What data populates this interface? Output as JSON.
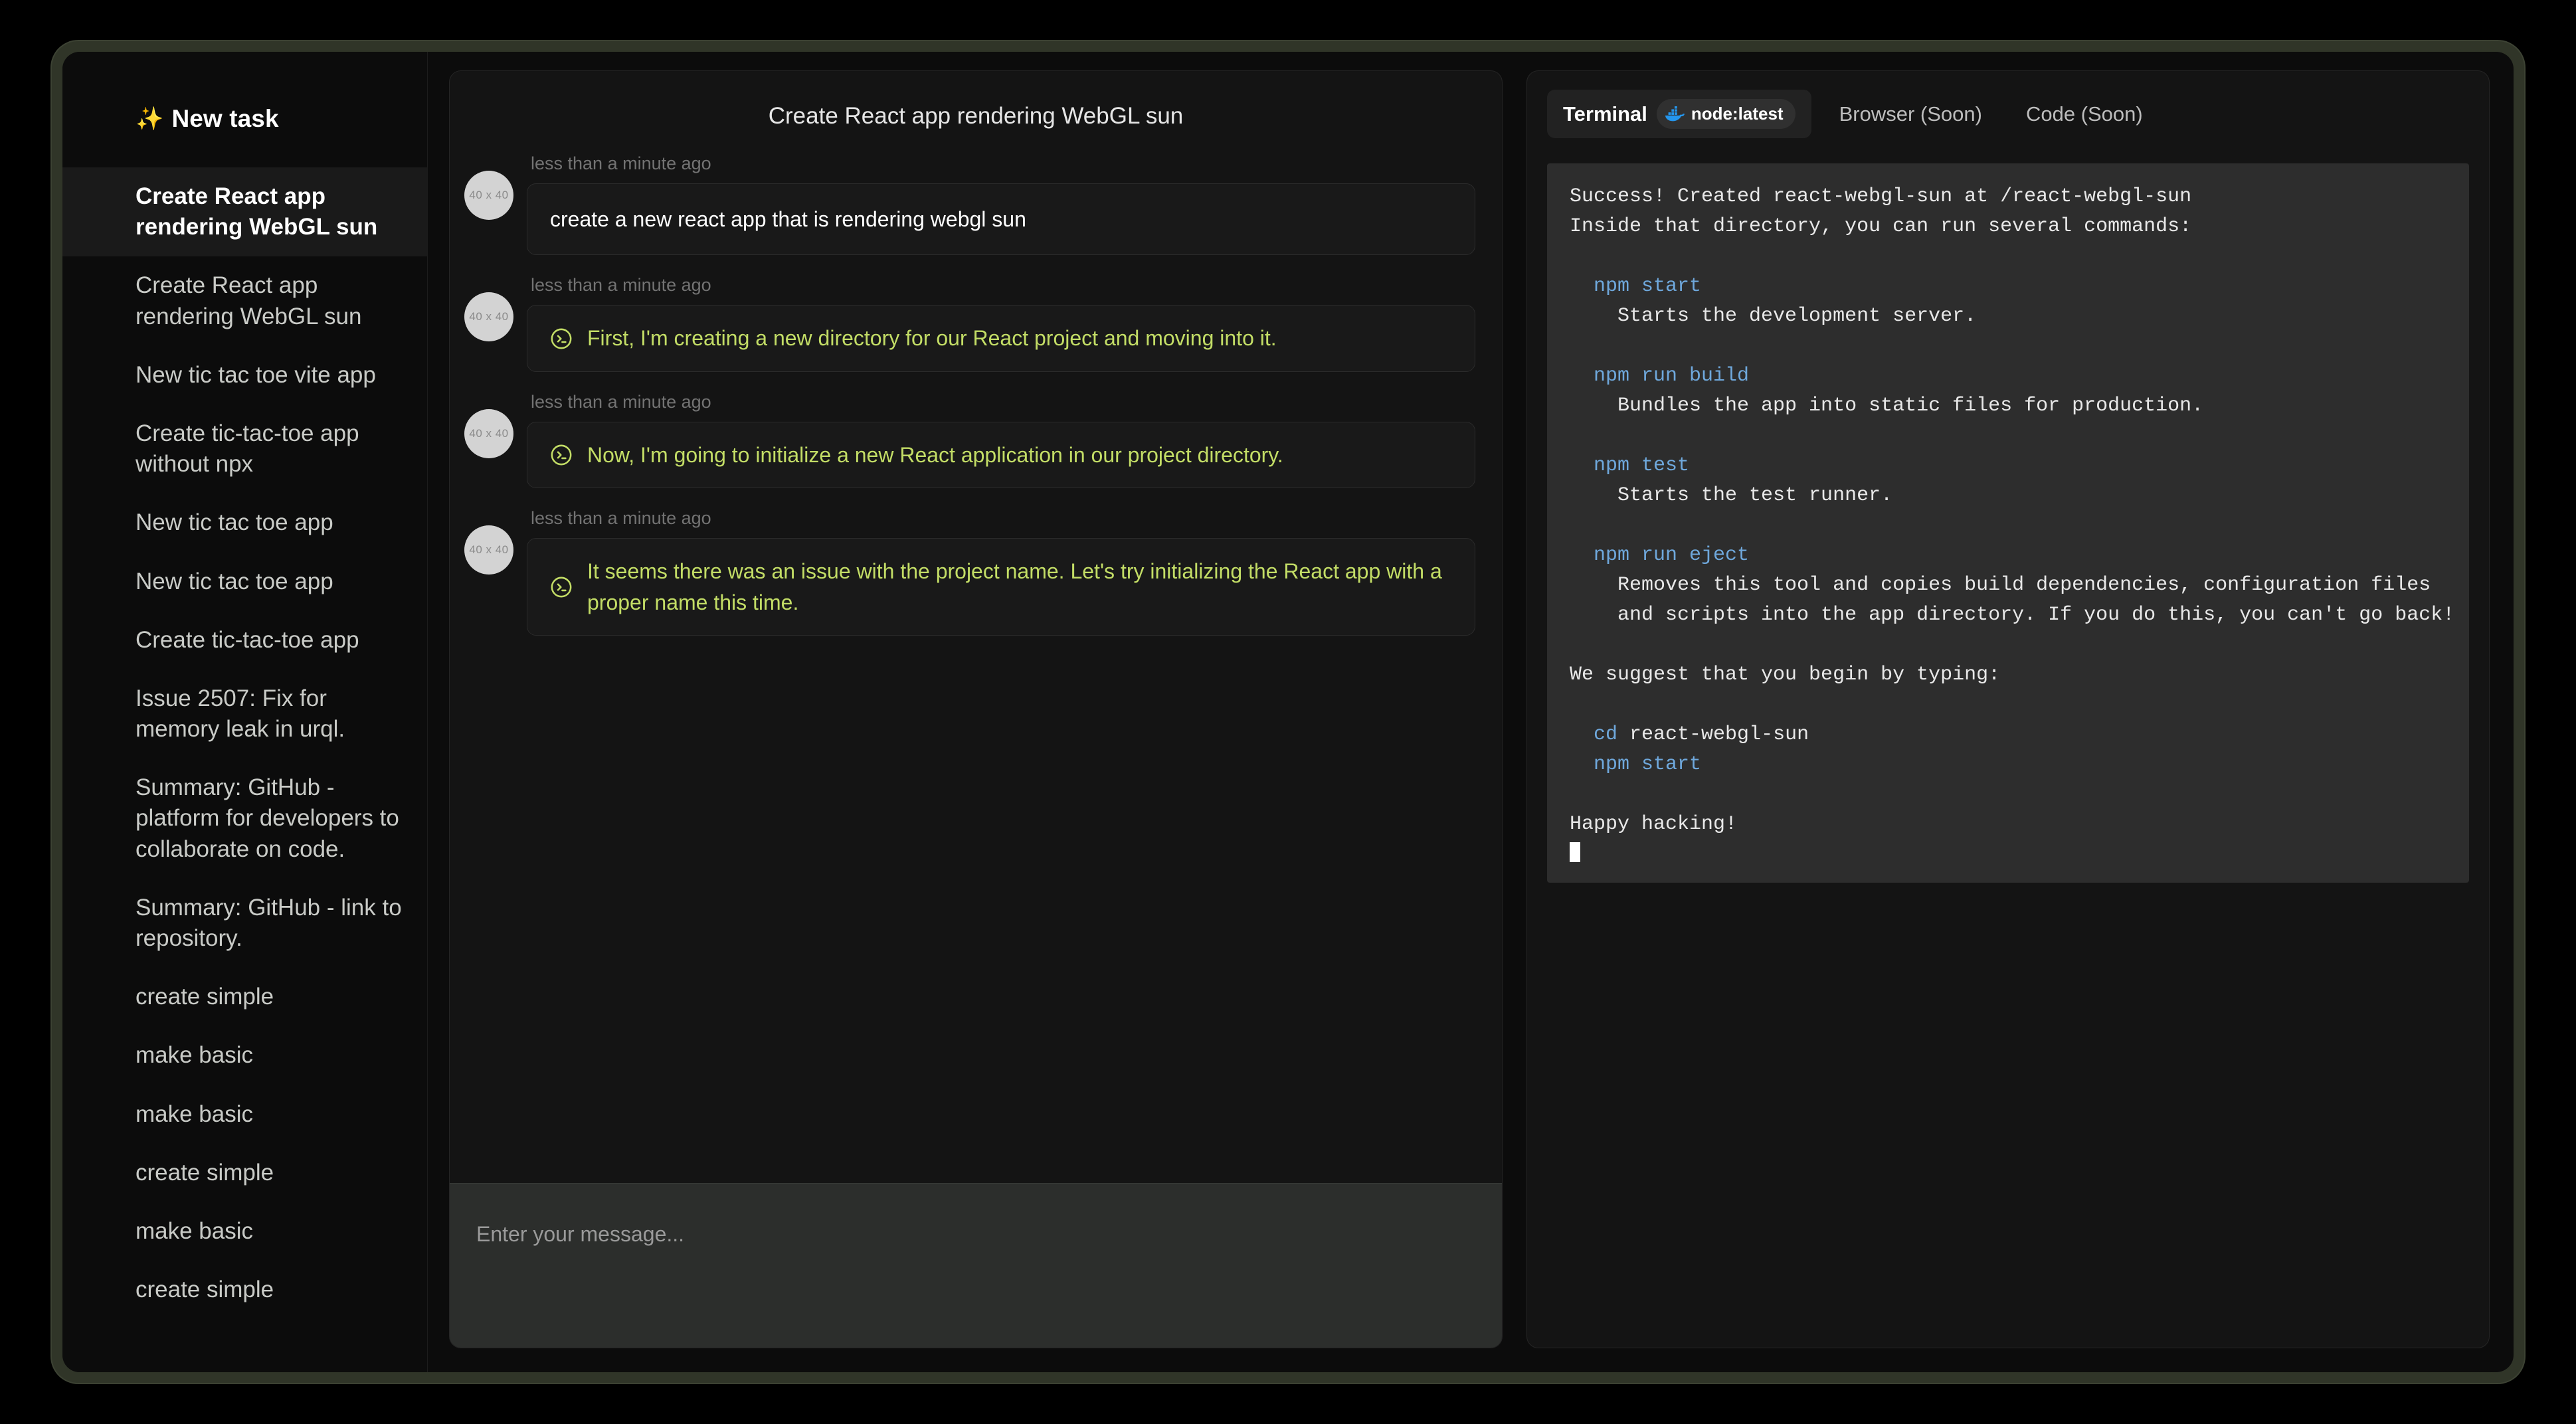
{
  "sidebar": {
    "new_task_label": "New task",
    "new_task_icon": "sparkles-icon",
    "items": [
      {
        "label": "Create React app rendering WebGL sun",
        "active": true
      },
      {
        "label": "Create React app rendering WebGL sun",
        "active": false
      },
      {
        "label": "New tic tac toe vite app",
        "active": false
      },
      {
        "label": "Create tic-tac-toe app without npx",
        "active": false
      },
      {
        "label": "New tic tac toe app",
        "active": false
      },
      {
        "label": "New tic tac toe app",
        "active": false
      },
      {
        "label": "Create tic-tac-toe app",
        "active": false
      },
      {
        "label": "Issue 2507: Fix for memory leak in urql.",
        "active": false
      },
      {
        "label": "Summary: GitHub - platform for developers to collaborate on code.",
        "active": false
      },
      {
        "label": "Summary: GitHub - link to repository.",
        "active": false
      },
      {
        "label": "create simple",
        "active": false
      },
      {
        "label": "make basic",
        "active": false
      },
      {
        "label": "make basic",
        "active": false
      },
      {
        "label": "create simple",
        "active": false
      },
      {
        "label": "make basic",
        "active": false
      },
      {
        "label": "create simple",
        "active": false
      }
    ]
  },
  "chat": {
    "title": "Create React app rendering WebGL sun",
    "avatar_placeholder": "40 x 40",
    "messages": [
      {
        "time": "less than a minute ago",
        "role": "user",
        "text": "create a new react app that is rendering webgl sun"
      },
      {
        "time": "less than a minute ago",
        "role": "agent",
        "icon": "terminal-prompt-icon",
        "text": "First, I'm creating a new directory for our React project and moving into it."
      },
      {
        "time": "less than a minute ago",
        "role": "agent",
        "icon": "terminal-prompt-icon",
        "text": "Now, I'm going to initialize a new React application in our project directory."
      },
      {
        "time": "less than a minute ago",
        "role": "agent",
        "icon": "terminal-prompt-icon",
        "text": "It seems there was an issue with the project name. Let's try initializing the React app with a proper name this time."
      }
    ],
    "composer_placeholder": "Enter your message...",
    "composer_value": ""
  },
  "tools": {
    "tabs": [
      {
        "label": "Terminal",
        "active": true,
        "badge": "node:latest",
        "badge_icon": "docker-whale-icon"
      },
      {
        "label": "Browser (Soon)",
        "active": false
      },
      {
        "label": "Code (Soon)",
        "active": false
      }
    ],
    "terminal": {
      "lines": [
        [
          {
            "t": "Success! Created react-webgl-sun at /react-webgl-sun",
            "c": "plain"
          }
        ],
        [
          {
            "t": "Inside that directory, you can run several commands:",
            "c": "plain"
          }
        ],
        [
          {
            "t": "",
            "c": "plain"
          }
        ],
        [
          {
            "t": "  ",
            "c": "plain"
          },
          {
            "t": "npm start",
            "c": "cmd"
          }
        ],
        [
          {
            "t": "    Starts the development server.",
            "c": "plain"
          }
        ],
        [
          {
            "t": "",
            "c": "plain"
          }
        ],
        [
          {
            "t": "  ",
            "c": "plain"
          },
          {
            "t": "npm run build",
            "c": "cmd"
          }
        ],
        [
          {
            "t": "    Bundles the app into static files for production.",
            "c": "plain"
          }
        ],
        [
          {
            "t": "",
            "c": "plain"
          }
        ],
        [
          {
            "t": "  ",
            "c": "plain"
          },
          {
            "t": "npm test",
            "c": "cmd"
          }
        ],
        [
          {
            "t": "    Starts the test runner.",
            "c": "plain"
          }
        ],
        [
          {
            "t": "",
            "c": "plain"
          }
        ],
        [
          {
            "t": "  ",
            "c": "plain"
          },
          {
            "t": "npm run eject",
            "c": "cmd"
          }
        ],
        [
          {
            "t": "    Removes this tool and copies build dependencies, configuration files",
            "c": "plain"
          }
        ],
        [
          {
            "t": "    and scripts into the app directory. If you do this, you can't go back!",
            "c": "plain"
          }
        ],
        [
          {
            "t": "",
            "c": "plain"
          }
        ],
        [
          {
            "t": "We suggest that you begin by typing:",
            "c": "plain"
          }
        ],
        [
          {
            "t": "",
            "c": "plain"
          }
        ],
        [
          {
            "t": "  ",
            "c": "plain"
          },
          {
            "t": "cd",
            "c": "cmd"
          },
          {
            "t": " react-webgl-sun",
            "c": "plain"
          }
        ],
        [
          {
            "t": "  ",
            "c": "plain"
          },
          {
            "t": "npm start",
            "c": "cmd"
          }
        ],
        [
          {
            "t": "",
            "c": "plain"
          }
        ],
        [
          {
            "t": "Happy hacking!",
            "c": "plain"
          }
        ]
      ],
      "cursor": true
    }
  },
  "colors": {
    "accent_green": "#c3dd66",
    "docker_blue": "#2496ED",
    "terminal_cmd_blue": "#6fa8dc",
    "frame": "#303528",
    "panel_bg": "#141414",
    "terminal_bg": "#2d2d2d"
  }
}
